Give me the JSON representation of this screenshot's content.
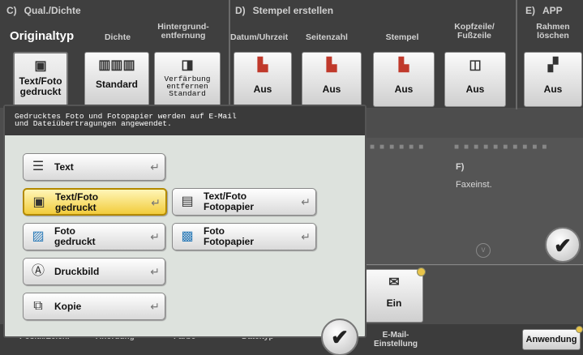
{
  "sections": {
    "c": {
      "letter": "C)",
      "title": "Qual./Dichte"
    },
    "d": {
      "letter": "D)",
      "title": "Stempel erstellen"
    },
    "e": {
      "letter": "E)",
      "title": "APP"
    }
  },
  "columns": {
    "originaltyp": "Originaltyp",
    "dichte": "Dichte",
    "hintergrund": "Hintergrund-\nentfernung",
    "datum": "Datum/Uhrzeit",
    "seitenzahl": "Seitenzahl",
    "stempel": "Stempel",
    "kopfzeile": "Kopfzeile/\nFußzeile",
    "rahmen": "Rahmen\nlöschen"
  },
  "tiles": {
    "originaltyp": "Text/Foto\ngedruckt",
    "dichte": "Standard",
    "hintergrund": "Verfärbung\nentfernen\nStandard",
    "datum": "Aus",
    "seitenzahl": "Aus",
    "stempel": "Aus",
    "kopfzeile": "Aus",
    "rahmen": "Aus"
  },
  "popup": {
    "info": "Gedrucktes Foto und Fotopapier werden auf E-Mail\nund Dateiübertragungen angewendet.",
    "options": [
      {
        "label": "Text",
        "icon": "text-doc-icon",
        "selected": false
      },
      {
        "label": "Text/Foto\ngedruckt",
        "icon": "text-photo-icon",
        "selected": true
      },
      {
        "label": "Text/Foto\nFotopapier",
        "icon": "text-photopaper-icon",
        "selected": false
      },
      {
        "label": "Foto\ngedruckt",
        "icon": "photo-printed-icon",
        "selected": false
      },
      {
        "label": "Foto\nFotopapier",
        "icon": "photo-paper-icon",
        "selected": false
      },
      {
        "label": "Druckbild",
        "icon": "print-image-icon",
        "selected": false
      },
      {
        "label": "Kopie",
        "icon": "copy-icon",
        "selected": false
      }
    ]
  },
  "right": {
    "f_label": "F)",
    "faxeinst": "Faxeinst."
  },
  "bottom": {
    "email_value": "Ein",
    "email_label": "E-Mail-\nEinstellung",
    "anwendung": "Anwendung",
    "b1": "Positi./Zeich.",
    "b2": "Anordung",
    "b3": "Farbe",
    "b4": "Dateityp"
  }
}
